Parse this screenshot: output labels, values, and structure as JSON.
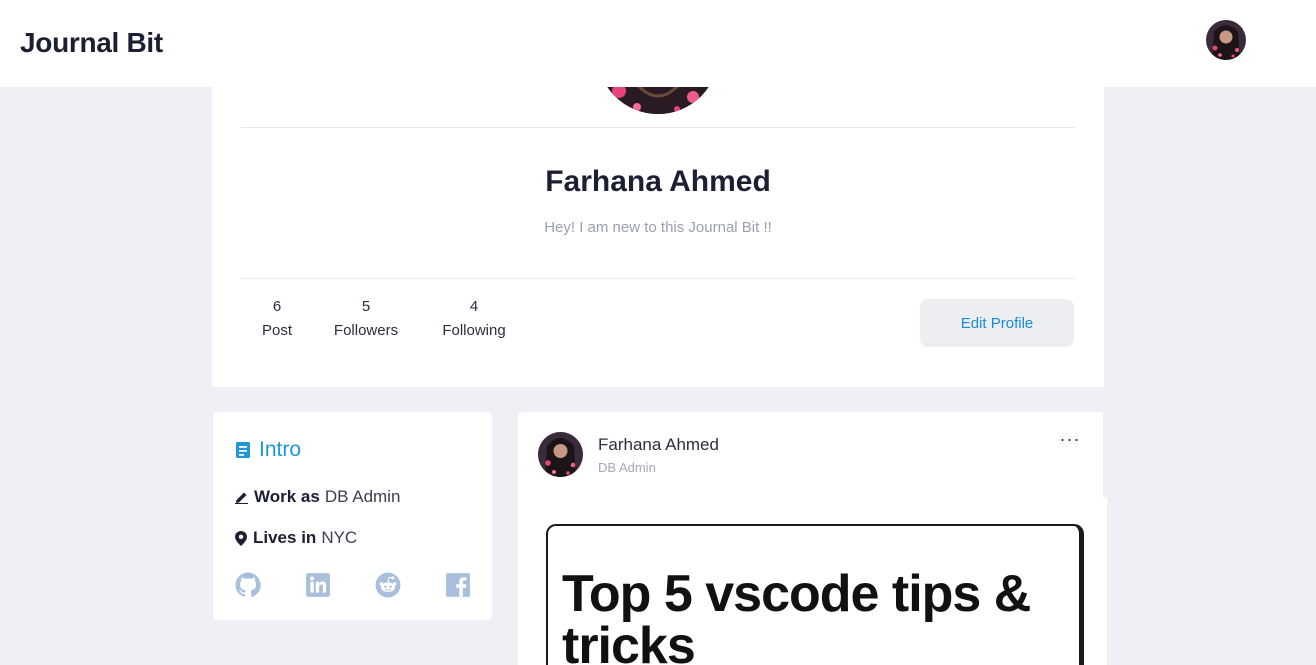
{
  "header": {
    "brand": "Journal Bit"
  },
  "profile": {
    "name": "Farhana Ahmed",
    "bio": "Hey! I am new to this Journal Bit !!",
    "stats": [
      {
        "value": "6",
        "label": "Post"
      },
      {
        "value": "5",
        "label": "Followers"
      },
      {
        "value": "4",
        "label": "Following"
      }
    ],
    "edit_label": "Edit Profile"
  },
  "intro": {
    "title": "Intro",
    "work_label": "Work as",
    "work_value": "DB Admin",
    "lives_label": "Lives in",
    "lives_value": "NYC",
    "socials": [
      "github-icon",
      "linkedin-icon",
      "reddit-icon",
      "facebook-icon"
    ]
  },
  "post": {
    "author": "Farhana Ahmed",
    "role": "DB Admin",
    "more": "···",
    "cover_title": "Top 5 vscode tips & tricks"
  },
  "colors": {
    "accent": "#1e96d8",
    "background": "#eef0f5",
    "social_icon": "#a9c0dc"
  }
}
